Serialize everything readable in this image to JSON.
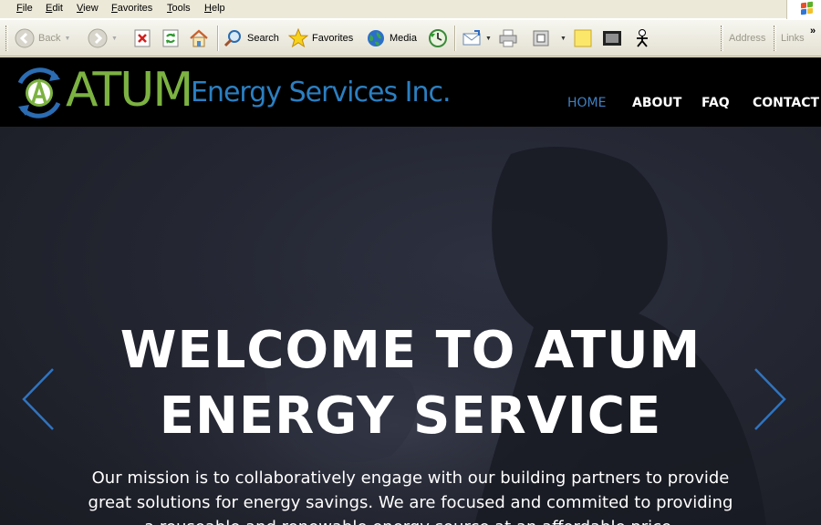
{
  "menubar": {
    "items": [
      {
        "label": "File",
        "key": "F",
        "rest": "ile"
      },
      {
        "label": "Edit",
        "key": "E",
        "rest": "dit"
      },
      {
        "label": "View",
        "key": "V",
        "rest": "iew"
      },
      {
        "label": "Favorites",
        "key": "F",
        "rest": "avorites",
        "prefix": ""
      },
      {
        "label": "Tools",
        "key": "T",
        "rest": "ools"
      },
      {
        "label": "Help",
        "key": "H",
        "rest": "elp"
      }
    ]
  },
  "toolbar": {
    "back_label": "Back",
    "search_label": "Search",
    "favorites_label": "Favorites",
    "media_label": "Media",
    "address_label": "Address",
    "links_label": "Links",
    "overflow": "»"
  },
  "site": {
    "brand_main": "ATUM",
    "brand_sub": "Energy Services Inc.",
    "nav": [
      "HOME",
      "ABOUT",
      "FAQ",
      "CONTACT"
    ],
    "hero": {
      "title_line1": "WELCOME TO ATUM",
      "title_line2": "ENERGY SERVICE",
      "text": "Our mission is to collaboratively engage with our building partners to provide great solutions for energy savings. We are focused and commited to providing a reuseable and renewable energy source at an affordable price."
    },
    "colors": {
      "brand_green": "#7cb241",
      "brand_blue": "#2b7fc1",
      "active_nav": "#3f7fc3",
      "header_bg": "#000000",
      "hero_bg": "#22242f"
    }
  },
  "icons": {
    "back": "back-arrow-icon",
    "forward": "forward-arrow-icon",
    "stop": "stop-icon",
    "refresh": "refresh-icon",
    "home": "home-icon",
    "search": "search-magnifier-icon",
    "favorites": "star-icon",
    "media": "globe-media-icon",
    "history": "history-icon",
    "mail": "mail-icon",
    "print": "printer-icon",
    "edit": "edit-icon",
    "note": "sticky-note-icon",
    "messenger": "messenger-icon",
    "slider_prev": "chevron-left-icon",
    "slider_next": "chevron-right-icon"
  }
}
